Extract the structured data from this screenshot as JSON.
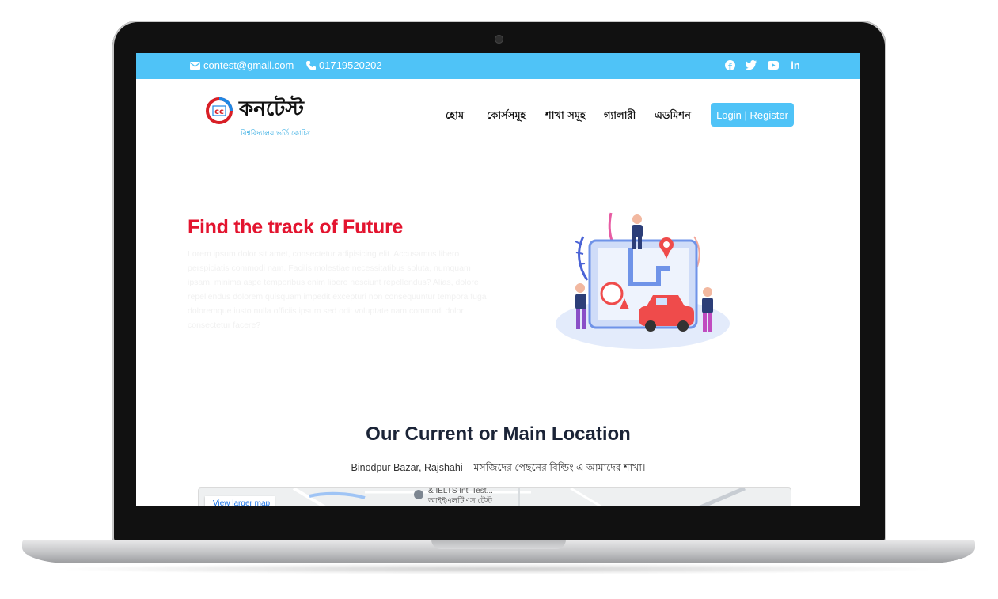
{
  "topbar": {
    "email": "contest@gmail.com",
    "phone": "01719520202",
    "social": [
      "facebook-icon",
      "twitter-icon",
      "youtube-icon",
      "linkedin-icon"
    ],
    "linkedin_label": "in"
  },
  "logo": {
    "title": "কনটেস্ট",
    "subtitle": "বিশ্ববিদ্যালয় ভর্তি কোচিং"
  },
  "nav": {
    "items": [
      "হোম",
      "কোর্সসমূহ",
      "শাখা সমূহ",
      "গ্যালারী",
      "এডমিশন"
    ],
    "login_label": "Login | Register"
  },
  "hero": {
    "title": "Find the track of Future",
    "text": "Lorem ipsum dolor sit amet, consectetur adipisicing elit. Accusamus libero perspiciatis commodi nam. Facilis molestiae necessitatibus soluta, numquam ipsam, minima aspe temporibus enim libero nesciunt repellendus? Alias, dolore repellendus dolorem quisquam impedit excepturi non consequuntur tempora fuga doloremque iusto nulla officiis ipsum sed odit voluptate nam commodi dolor consectetur facere?"
  },
  "location": {
    "title": "Our Current or Main Location",
    "subtitle": "Binodpur Bazar, Rajshahi – মসজিদের পেছনের বিল্ডিং এ আমাদের শাখা।",
    "map_link": "View larger map",
    "map_label_1": "& IELTS Intl Test...",
    "map_label_2": "আইইএলটিএস টেস্ট"
  },
  "colors": {
    "accent": "#4fc3f7",
    "headline": "#e3142f",
    "heading": "#1b2437"
  }
}
